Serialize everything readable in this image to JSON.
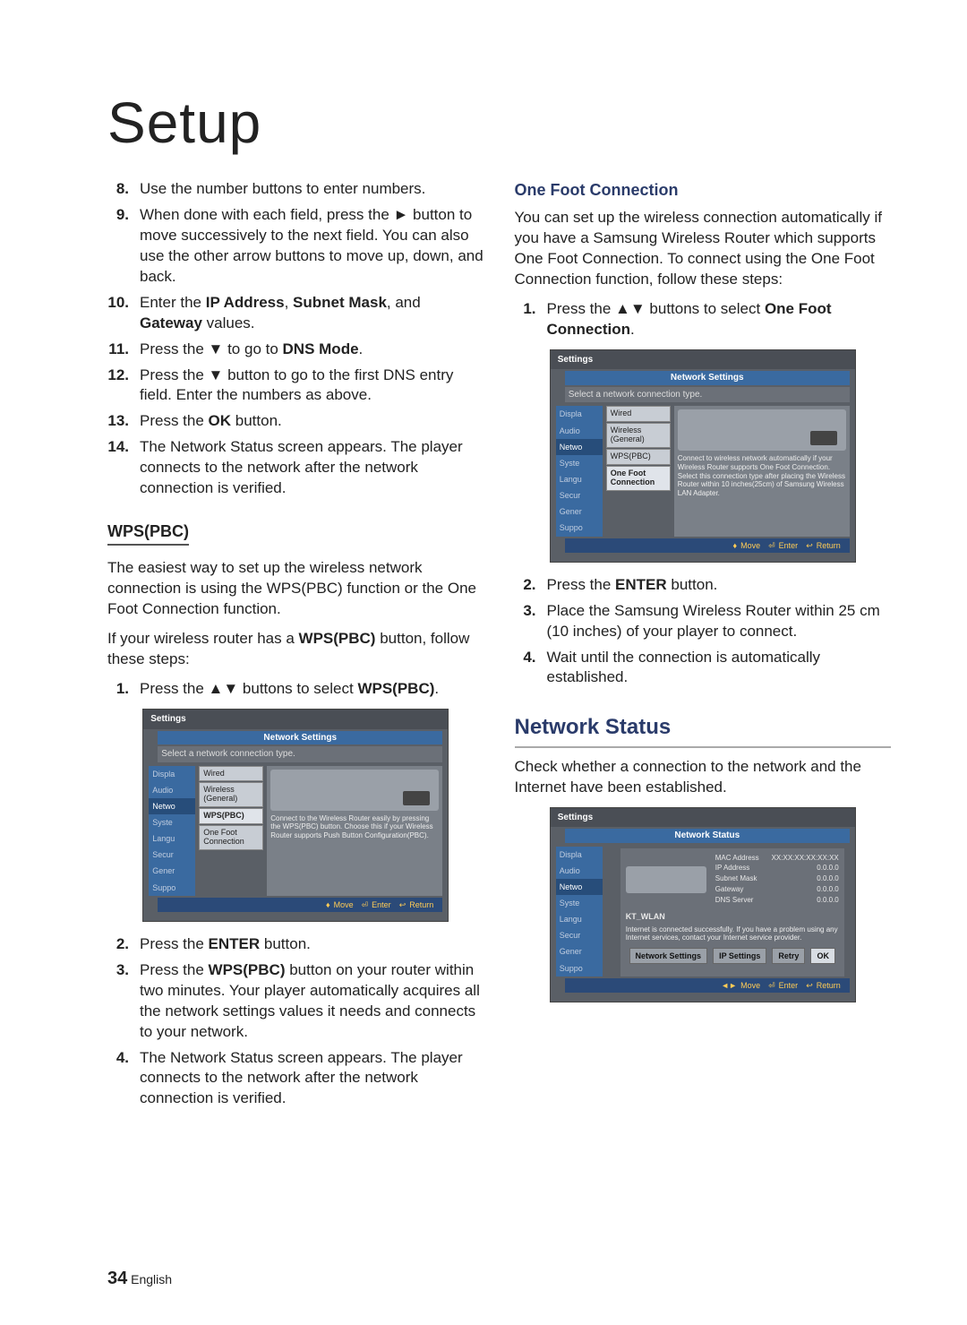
{
  "title": "Setup",
  "left": {
    "steps8to14": [
      {
        "n": "8.",
        "html": "Use the number buttons to enter numbers."
      },
      {
        "n": "9.",
        "html": "When done with each field, press the ► button to move successively to the next field. You can also use the other arrow buttons to move up, down, and back."
      },
      {
        "n": "10.",
        "html": "Enter the <b>IP Address</b>, <b>Subnet Mask</b>, and <b>Gateway</b> values."
      },
      {
        "n": "11.",
        "html": "Press the ▼ to go to <b>DNS Mode</b>."
      },
      {
        "n": "12.",
        "html": "Press the ▼ button to go to the first DNS entry field. Enter the numbers as above."
      },
      {
        "n": "13.",
        "html": "Press the <b>OK</b> button."
      },
      {
        "n": "14.",
        "html": "The Network Status screen appears. The player connects to the network after the network connection is verified."
      }
    ],
    "wps_heading": "WPS(PBC)",
    "wps_p1": "The easiest way to set up the wireless network connection is using the WPS(PBC) function or the One Foot Connection function.",
    "wps_p2_html": "If your wireless router has a <b>WPS(PBC)</b> button, follow these steps:",
    "wps_step1_html": "Press the ▲▼ buttons to select <b>WPS(PBC)</b>.",
    "screenshot1": {
      "settings": "Settings",
      "netset": "Network Settings",
      "select": "Select a network connection type.",
      "sidebar": [
        "Displa",
        "Audio",
        "Netwo",
        "Syste",
        "Langu",
        "Secur",
        "Gener",
        "Suppo"
      ],
      "options": [
        "Wired",
        "Wireless (General)",
        "WPS(PBC)",
        "One Foot Connection"
      ],
      "selected_index": 2,
      "helptext": "Connect to the Wireless Router easily by pressing the WPS(PBC) button. Choose this if your Wireless Router supports Push Button Configuration(PBC).",
      "footer_move": "Move",
      "footer_enter": "Enter",
      "footer_return": "Return"
    },
    "wps_steps2to4": [
      {
        "n": "2.",
        "html": "Press the <b>ENTER</b> button."
      },
      {
        "n": "3.",
        "html": "Press the <b>WPS(PBC)</b> button on your router within two minutes. Your player automatically acquires all the network settings values it needs and connects to your network."
      },
      {
        "n": "4.",
        "html": "The Network Status screen appears. The player connects to the network after the network connection is verified."
      }
    ]
  },
  "right": {
    "ofc_heading": "One Foot Connection",
    "ofc_p1": "You can set up the wireless connection automatically if you have a Samsung Wireless Router which supports One Foot Connection. To connect using the One Foot Connection function, follow these steps:",
    "ofc_step1_html": "Press the ▲▼ buttons to select <b>One Foot Connection</b>.",
    "screenshot2": {
      "settings": "Settings",
      "netset": "Network Settings",
      "select": "Select a network connection type.",
      "sidebar": [
        "Displa",
        "Audio",
        "Netwo",
        "Syste",
        "Langu",
        "Secur",
        "Gener",
        "Suppo"
      ],
      "options": [
        "Wired",
        "Wireless (General)",
        "WPS(PBC)",
        "One Foot Connection"
      ],
      "selected_index": 3,
      "helptext": "Connect to wireless network automatically if your Wireless Router supports One Foot Connection. Select this connection type after placing the Wireless Router within 10 inches(25cm) of Samsung Wireless LAN Adapter.",
      "footer_move": "Move",
      "footer_enter": "Enter",
      "footer_return": "Return"
    },
    "ofc_steps2to4": [
      {
        "n": "2.",
        "html": "Press the <b>ENTER</b> button."
      },
      {
        "n": "3.",
        "html": "Place the Samsung Wireless Router within 25 cm (10 inches) of your player to connect."
      },
      {
        "n": "4.",
        "html": "Wait until the connection is automatically established."
      }
    ],
    "ns_heading": "Network Status",
    "ns_p1": "Check whether a connection to the network and the Internet have been established.",
    "screenshot3": {
      "settings": "Settings",
      "title": "Network Status",
      "sidebar": [
        "Displa",
        "Audio",
        "Netwo",
        "Syste",
        "Langu",
        "Secur",
        "Gener",
        "Suppo"
      ],
      "ssid": "KT_WLAN",
      "kv": [
        {
          "k": "MAC Address",
          "v": "XX:XX:XX:XX:XX:XX"
        },
        {
          "k": "IP Address",
          "v": "0.0.0.0"
        },
        {
          "k": "Subnet Mask",
          "v": "0.0.0.0"
        },
        {
          "k": "Gateway",
          "v": "0.0.0.0"
        },
        {
          "k": "DNS Server",
          "v": "0.0.0.0"
        }
      ],
      "note": "Internet is connected successfully.\nIf you have a problem using any Internet services, contact your Internet service provider.",
      "buttons": [
        "Network Settings",
        "IP Settings",
        "Retry",
        "OK"
      ],
      "footer_move": "Move",
      "footer_enter": "Enter",
      "footer_return": "Return"
    }
  },
  "footer": {
    "page_number": "34",
    "lang": "English"
  }
}
